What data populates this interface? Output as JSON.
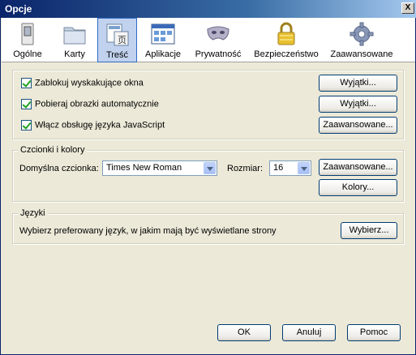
{
  "window": {
    "title": "Opcje",
    "close_label": "X"
  },
  "toolbar": {
    "items": [
      {
        "label": "Ogólne",
        "icon": "switch-icon"
      },
      {
        "label": "Karty",
        "icon": "folder-icon"
      },
      {
        "label": "Treść",
        "icon": "content-icon"
      },
      {
        "label": "Aplikacje",
        "icon": "applications-icon"
      },
      {
        "label": "Prywatność",
        "icon": "mask-icon"
      },
      {
        "label": "Bezpieczeństwo",
        "icon": "padlock-icon"
      },
      {
        "label": "Zaawansowane",
        "icon": "gear-icon"
      }
    ],
    "selected": "Treść"
  },
  "content": {
    "popup_block": {
      "label": "Zablokuj wyskakujące okna",
      "checked": true,
      "button": "Wyjątki..."
    },
    "load_images": {
      "label": "Pobieraj obrazki automatycznie",
      "checked": true,
      "button": "Wyjątki..."
    },
    "javascript": {
      "label": "Włącz obsługę języka JavaScript",
      "checked": true,
      "button": "Zaawansowane..."
    },
    "fonts": {
      "caption": "Czcionki i kolory",
      "default_font_label": "Domyślna czcionka:",
      "default_font_value": "Times New Roman",
      "size_label": "Rozmiar:",
      "size_value": "16",
      "advanced_button": "Zaawansowane...",
      "colors_button": "Kolory..."
    },
    "languages": {
      "caption": "Języki",
      "description": "Wybierz preferowany język, w jakim mają być wyświetlane strony",
      "choose_button": "Wybierz..."
    }
  },
  "footer": {
    "ok": "OK",
    "cancel": "Anuluj",
    "help": "Pomoc"
  }
}
